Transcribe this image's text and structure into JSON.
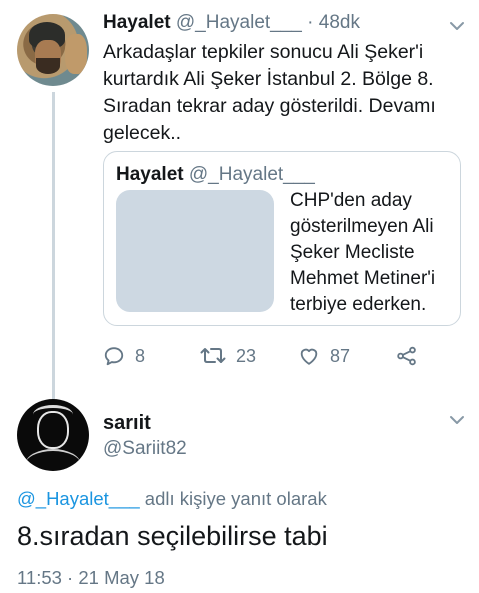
{
  "tweet": {
    "author_name": "Hayalet",
    "author_handle": "@_Hayalet___",
    "time": "· 48dk",
    "text": "Arkadaşlar tepkiler sonucu Ali Şeker'i kurtardık Ali Şeker İstanbul 2. Bölge 8. Sıradan tekrar aday gösterildi. Devamı gelecek..",
    "quote": {
      "author_name": "Hayalet",
      "author_handle": "@_Hayalet___",
      "text": "CHP'den aday gösterilmeyen Ali Şeker Mecliste Mehmet Metiner'i terbiye ederken."
    },
    "actions": {
      "replies": "8",
      "retweets": "23",
      "likes": "87"
    },
    "icons": [
      "reply-icon",
      "retweet-icon",
      "like-icon",
      "share-icon",
      "chevron-down-icon"
    ]
  },
  "reply_tweet": {
    "author_name": "sarıit",
    "author_handle": "@Sariit82",
    "reply_to_mention": "@_Hayalet___",
    "reply_to_suffix": " adlı kişiye yanıt olarak",
    "text": "8.sıradan seçilebilirse tabi",
    "timestamp": "11:53 · 21 May 18"
  },
  "colors": {
    "text": "#14171a",
    "secondary": "#657786",
    "link": "#1b95e0",
    "border": "#ccd6dd"
  }
}
